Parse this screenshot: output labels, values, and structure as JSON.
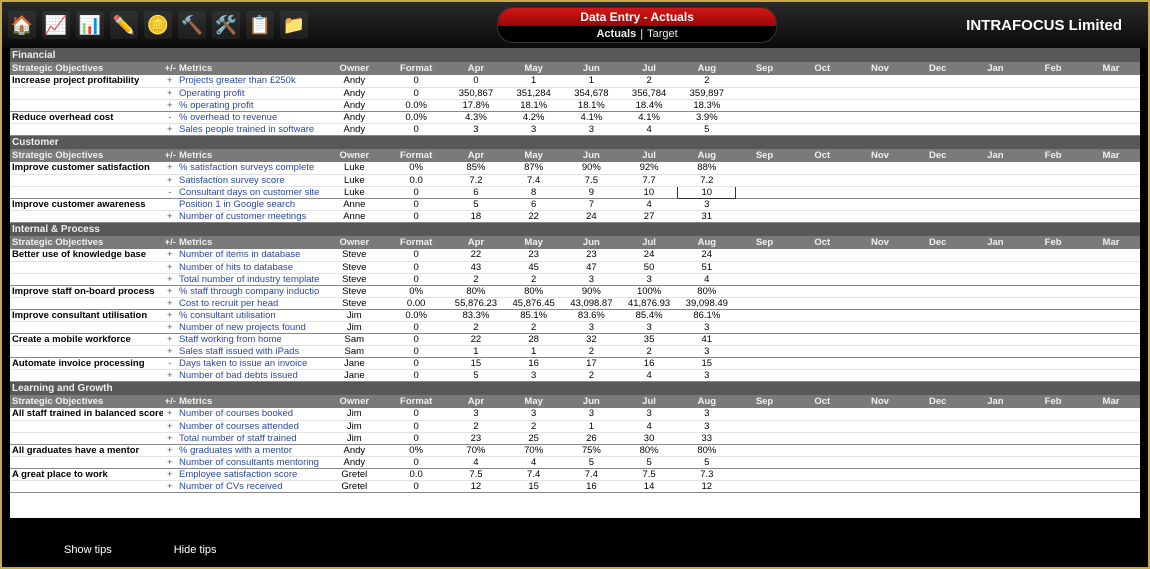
{
  "header": {
    "title": "Data Entry - Actuals",
    "tab_actuals": "Actuals",
    "tab_target": "Target",
    "brand": "INTRAFOCUS Limited"
  },
  "icons": [
    "home-icon",
    "chart-icon",
    "bars-icon",
    "pen-icon",
    "coins-icon",
    "hammer-icon",
    "tools-icon",
    "clipboard-icon",
    "folder-icon"
  ],
  "cols": {
    "so": "Strategic Objectives",
    "pm": "+/-",
    "metrics": "Metrics",
    "owner": "Owner",
    "format": "Format",
    "months": [
      "Apr",
      "May",
      "Jun",
      "Jul",
      "Aug",
      "Sep",
      "Oct",
      "Nov",
      "Dec",
      "Jan",
      "Feb",
      "Mar"
    ]
  },
  "buttons": {
    "show": "Show tips",
    "hide": "Hide tips"
  },
  "sections": [
    {
      "name": "Financial",
      "objectives": [
        {
          "name": "Increase project profitability",
          "metrics": [
            {
              "pm": "+",
              "m": "Projects greater than £250k",
              "o": "Andy",
              "f": "0",
              "v": [
                "0",
                "1",
                "1",
                "2",
                "2"
              ]
            },
            {
              "pm": "+",
              "m": "Operating profit",
              "o": "Andy",
              "f": "0",
              "v": [
                "350,867",
                "351,284",
                "354,678",
                "356,784",
                "359,897"
              ]
            },
            {
              "pm": "+",
              "m": "% operating profit",
              "o": "Andy",
              "f": "0.0%",
              "v": [
                "17.8%",
                "18.1%",
                "18.1%",
                "18.4%",
                "18.3%"
              ]
            }
          ]
        },
        {
          "name": "Reduce overhead cost",
          "metrics": [
            {
              "pm": "-",
              "m": "% overhead to revenue",
              "o": "Andy",
              "f": "0.0%",
              "v": [
                "4.3%",
                "4.2%",
                "4.1%",
                "4.1%",
                "3.9%"
              ]
            },
            {
              "pm": "+",
              "m": "Sales people trained in software",
              "o": "Andy",
              "f": "0",
              "v": [
                "3",
                "3",
                "3",
                "4",
                "5"
              ]
            }
          ]
        }
      ]
    },
    {
      "name": "Customer",
      "objectives": [
        {
          "name": "Improve customer satisfaction",
          "metrics": [
            {
              "pm": "+",
              "m": "% satisfaction surveys complete",
              "o": "Luke",
              "f": "0%",
              "v": [
                "85%",
                "87%",
                "90%",
                "92%",
                "88%"
              ]
            },
            {
              "pm": "+",
              "m": "Satisfaction survey score",
              "o": "Luke",
              "f": "0.0",
              "v": [
                "7.2",
                "7.4",
                "7.5",
                "7.7",
                "7.2"
              ]
            },
            {
              "pm": "-",
              "m": "Consultant days on customer site",
              "o": "Luke",
              "f": "0",
              "v": [
                "6",
                "8",
                "9",
                "10",
                "10"
              ],
              "sel": 4
            }
          ]
        },
        {
          "name": "Improve customer awareness",
          "metrics": [
            {
              "pm": "",
              "m": "Position 1 in Google search",
              "o": "Anne",
              "f": "0",
              "v": [
                "5",
                "6",
                "7",
                "4",
                "3"
              ]
            },
            {
              "pm": "+",
              "m": "Number of customer meetings",
              "o": "Anne",
              "f": "0",
              "v": [
                "18",
                "22",
                "24",
                "27",
                "31"
              ]
            }
          ]
        }
      ]
    },
    {
      "name": "Internal & Process",
      "objectives": [
        {
          "name": "Better use of knowledge base",
          "metrics": [
            {
              "pm": "+",
              "m": "Number of items in database",
              "o": "Steve",
              "f": "0",
              "v": [
                "22",
                "23",
                "23",
                "24",
                "24"
              ]
            },
            {
              "pm": "+",
              "m": "Number of hits to database",
              "o": "Steve",
              "f": "0",
              "v": [
                "43",
                "45",
                "47",
                "50",
                "51"
              ]
            },
            {
              "pm": "+",
              "m": "Total number of industry template",
              "o": "Steve",
              "f": "0",
              "v": [
                "2",
                "2",
                "3",
                "3",
                "4"
              ]
            }
          ]
        },
        {
          "name": "Improve staff on-board process",
          "metrics": [
            {
              "pm": "+",
              "m": "% staff through company inductio",
              "o": "Steve",
              "f": "0%",
              "v": [
                "80%",
                "80%",
                "90%",
                "100%",
                "80%"
              ]
            },
            {
              "pm": "+",
              "m": "Cost to recruit per head",
              "o": "Steve",
              "f": "0.00",
              "v": [
                "55,876.23",
                "45,876.45",
                "43,098.87",
                "41,876.93",
                "39,098.49"
              ]
            }
          ]
        },
        {
          "name": "Improve consultant utilisation",
          "metrics": [
            {
              "pm": "+",
              "m": "% consultant utilisation",
              "o": "Jim",
              "f": "0.0%",
              "v": [
                "83.3%",
                "85.1%",
                "83.6%",
                "85.4%",
                "86.1%"
              ]
            },
            {
              "pm": "+",
              "m": "Number of new projects found",
              "o": "Jim",
              "f": "0",
              "v": [
                "2",
                "2",
                "3",
                "3",
                "3"
              ]
            }
          ]
        },
        {
          "name": "Create a mobile workforce",
          "metrics": [
            {
              "pm": "+",
              "m": "Staff working from home",
              "o": "Sam",
              "f": "0",
              "v": [
                "22",
                "28",
                "32",
                "35",
                "41"
              ]
            },
            {
              "pm": "+",
              "m": "Sales staff issued with iPads",
              "o": "Sam",
              "f": "0",
              "v": [
                "1",
                "1",
                "2",
                "2",
                "3"
              ]
            }
          ]
        },
        {
          "name": "Automate invoice processing",
          "metrics": [
            {
              "pm": "-",
              "m": "Days taken to issue an invoice",
              "o": "Jane",
              "f": "0",
              "v": [
                "15",
                "16",
                "17",
                "16",
                "15"
              ]
            },
            {
              "pm": "+",
              "m": "Number of bad debts issued",
              "o": "Jane",
              "f": "0",
              "v": [
                "5",
                "3",
                "2",
                "4",
                "3"
              ]
            }
          ]
        }
      ]
    },
    {
      "name": "Learning and Growth",
      "objectives": [
        {
          "name": "All staff trained in balanced score",
          "metrics": [
            {
              "pm": "+",
              "m": "Number of courses booked",
              "o": "Jim",
              "f": "0",
              "v": [
                "3",
                "3",
                "3",
                "3",
                "3"
              ]
            },
            {
              "pm": "+",
              "m": "Number of courses attended",
              "o": "Jim",
              "f": "0",
              "v": [
                "2",
                "2",
                "1",
                "4",
                "3"
              ]
            },
            {
              "pm": "+",
              "m": "Total number of staff trained",
              "o": "Jim",
              "f": "0",
              "v": [
                "23",
                "25",
                "26",
                "30",
                "33"
              ]
            }
          ]
        },
        {
          "name": "All graduates have a mentor",
          "metrics": [
            {
              "pm": "+",
              "m": "% graduates with a mentor",
              "o": "Andy",
              "f": "0%",
              "v": [
                "70%",
                "70%",
                "75%",
                "80%",
                "80%"
              ]
            },
            {
              "pm": "+",
              "m": "Number of consultants mentoring",
              "o": "Andy",
              "f": "0",
              "v": [
                "4",
                "4",
                "5",
                "5",
                "5"
              ]
            }
          ]
        },
        {
          "name": "A great place to work",
          "metrics": [
            {
              "pm": "+",
              "m": "Employee satisfaction score",
              "o": "Gretel",
              "f": "0.0",
              "v": [
                "7.5",
                "7.4",
                "7.4",
                "7.5",
                "7.3"
              ]
            },
            {
              "pm": "+",
              "m": "Number of CVs received",
              "o": "Gretel",
              "f": "0",
              "v": [
                "12",
                "15",
                "16",
                "14",
                "12"
              ]
            }
          ]
        }
      ]
    }
  ]
}
